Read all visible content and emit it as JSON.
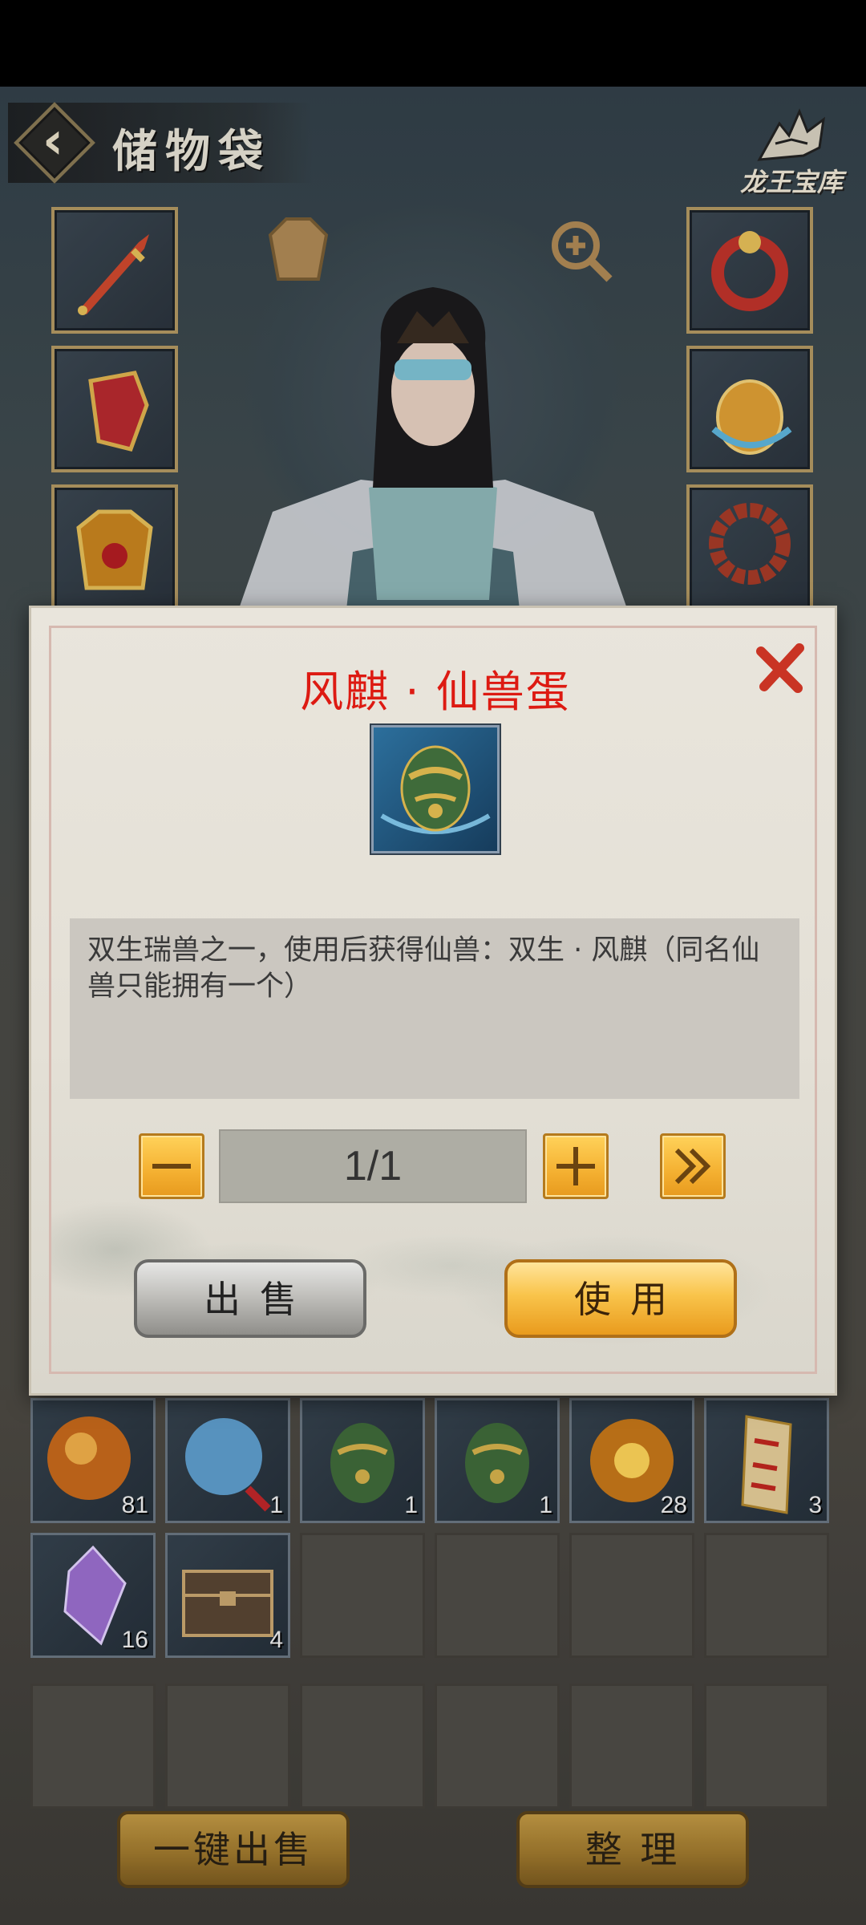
{
  "header": {
    "title": "储物袋",
    "treasury_label": "龙王宝库"
  },
  "equipment": {
    "left": [
      "sword-icon",
      "gauntlet-icon",
      "armor-icon"
    ],
    "right": [
      "ring-icon",
      "amulet-icon",
      "prayer-beads-icon"
    ],
    "center": [
      "outfit-icon",
      "zoom-in-icon"
    ]
  },
  "inventory": {
    "rows": [
      [
        {
          "icon": "fire-orb-icon",
          "count": "81"
        },
        {
          "icon": "water-orb-icon",
          "count": "1"
        },
        {
          "icon": "beast-egg-icon",
          "count": "1"
        },
        {
          "icon": "beast-egg-icon",
          "count": "1"
        },
        {
          "icon": "golden-orb-icon",
          "count": "28"
        },
        {
          "icon": "talisman-icon",
          "count": "3"
        }
      ],
      [
        {
          "icon": "crystal-icon",
          "count": "16"
        },
        {
          "icon": "treasure-chest-icon",
          "count": "4"
        },
        null,
        null,
        null,
        null
      ],
      [
        null,
        null,
        null,
        null,
        null,
        null
      ]
    ]
  },
  "bottom_buttons": {
    "sell_all": "一键出售",
    "sort": "整 理"
  },
  "dialog": {
    "item_name": "风麒 · 仙兽蛋",
    "item_icon": "beast-egg-icon",
    "description": "双生瑞兽之一，使用后获得仙兽：双生 · 风麒（同名仙兽只能拥有一个）",
    "quantity": "1/1",
    "sell_label": "出售",
    "use_label": "使用"
  },
  "colors": {
    "item_name": "#dd1a12",
    "gold_button": "#f9c44b",
    "silver_button": "#bdbcb8"
  }
}
